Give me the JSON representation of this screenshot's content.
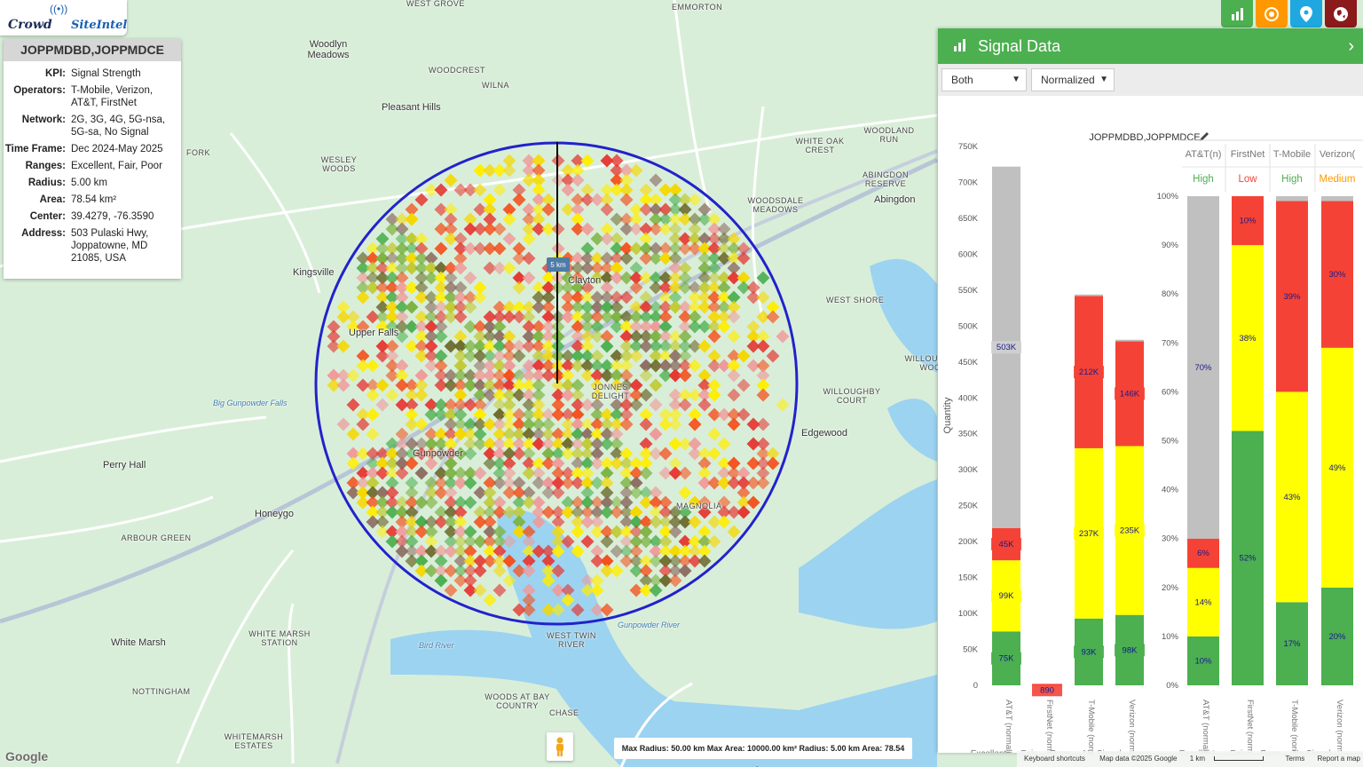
{
  "logo": {
    "part1": "Crowd",
    "part2": "SiteIntel"
  },
  "info": {
    "title": "JOPPMDBD,JOPPMDCE",
    "rows": [
      {
        "k": "KPI:",
        "v": "Signal Strength"
      },
      {
        "k": "Operators:",
        "v": "T-Mobile, Verizon, AT&T, FirstNet"
      },
      {
        "k": "Network:",
        "v": "2G, 3G, 4G, 5G-nsa, 5G-sa, No Signal"
      },
      {
        "k": "Time Frame:",
        "v": "Dec 2024-May 2025"
      },
      {
        "k": "Ranges:",
        "v": "Excellent, Fair, Poor"
      },
      {
        "k": "Radius:",
        "v": "5.00 km"
      },
      {
        "k": "Area:",
        "v": "78.54 km²"
      },
      {
        "k": "Center:",
        "v": "39.4279, -76.3590"
      },
      {
        "k": "Address:",
        "v": "503 Pulaski Hwy, Joppatowne, MD 21085, USA"
      }
    ]
  },
  "toolbar": {
    "colors": {
      "chart": "#4caf50",
      "target": "#ff9800",
      "pin": "#1fa8e0",
      "globe": "#8b1a1a"
    }
  },
  "panel": {
    "title": "Signal Data",
    "operator_filter": "Both",
    "mode_select": "Normalized",
    "chart_title": "JOPPMDBD,JOPPMDCE"
  },
  "map": {
    "places": [
      {
        "t": "WEST GROVE",
        "c": "small"
      },
      {
        "t": "EMMORTON",
        "c": "small"
      },
      {
        "t": "Woodlyn Meadows",
        "c": ""
      },
      {
        "t": "WOODCREST",
        "c": "small"
      },
      {
        "t": "WILNA",
        "c": "small"
      },
      {
        "t": "Pleasant Hills",
        "c": ""
      },
      {
        "t": "WOODLAND RUN",
        "c": "small"
      },
      {
        "t": "WHITE OAK CREST",
        "c": "small"
      },
      {
        "t": "ABINGDON RESERVE",
        "c": "small"
      },
      {
        "t": "Abingdon",
        "c": ""
      },
      {
        "t": "WOODSDALE MEADOWS",
        "c": "small"
      },
      {
        "t": "FORK",
        "c": "small"
      },
      {
        "t": "WESLEY WOODS",
        "c": "small"
      },
      {
        "t": "Kingsville",
        "c": ""
      },
      {
        "t": "WEST SHORE",
        "c": "small"
      },
      {
        "t": "WILLOUGHBY WOOD",
        "c": "small"
      },
      {
        "t": "WILLOUGHBY COURT",
        "c": "small"
      },
      {
        "t": "Edgewood",
        "c": ""
      },
      {
        "t": "Perry Hall",
        "c": ""
      },
      {
        "t": "Honeygo",
        "c": ""
      },
      {
        "t": "ARBOUR GREEN",
        "c": "small"
      },
      {
        "t": "White Marsh",
        "c": ""
      },
      {
        "t": "WHITE MARSH STATION",
        "c": "small"
      },
      {
        "t": "NOTTINGHAM",
        "c": "small"
      },
      {
        "t": "WHITEMARSH ESTATES",
        "c": "small"
      },
      {
        "t": "WEST TWIN RIVER",
        "c": "small"
      },
      {
        "t": "WOODS AT BAY COUNTRY",
        "c": "small"
      },
      {
        "t": "CHASE",
        "c": "small"
      },
      {
        "t": "MAGNOLIA",
        "c": "small"
      },
      {
        "t": "Bird River",
        "c": "water"
      },
      {
        "t": "Gunpowder River",
        "c": "water"
      },
      {
        "t": "Big Gunpowder Falls",
        "c": "water"
      },
      {
        "t": "Clayton",
        "c": ""
      },
      {
        "t": "JONNES DELIGHT",
        "c": "small"
      },
      {
        "t": "Upper Falls",
        "c": ""
      },
      {
        "t": "Gunpowder",
        "c": ""
      }
    ],
    "radius_label": "5 km"
  },
  "footer": {
    "stats": "Max Radius: 50.00 km  Max Area: 10000.00 km²  Radius: 5.00 km  Area: 78.54 km²",
    "google": "Google",
    "links": [
      "Keyboard shortcuts",
      "Map data ©2025 Google",
      "1 km",
      "Terms",
      "Report a map error"
    ]
  },
  "chart_data": [
    {
      "type": "bar",
      "stacked": true,
      "ylabel": "Quantity",
      "ylim": [
        0,
        750000
      ],
      "yticks": [
        "0",
        "50K",
        "100K",
        "150K",
        "200K",
        "250K",
        "300K",
        "350K",
        "400K",
        "450K",
        "500K",
        "550K",
        "600K",
        "650K",
        "700K",
        "750K"
      ],
      "categories": [
        "AT&T (normalized)",
        "FirstNet (normalized)",
        "T-Mobile (normalized)",
        "Verizon (normalized)"
      ],
      "series": [
        {
          "name": "Excellent",
          "color": "#4caf50",
          "values": [
            75000,
            0,
            93000,
            98000
          ],
          "labels": [
            "75K",
            "",
            "93K",
            "98K"
          ]
        },
        {
          "name": "Fair",
          "color": "#ffff00",
          "values": [
            99000,
            0,
            237000,
            235000
          ],
          "labels": [
            "99K",
            "",
            "237K",
            "235K"
          ]
        },
        {
          "name": "Poor",
          "color": "#f44336",
          "values": [
            45000,
            890,
            212000,
            146000
          ],
          "labels": [
            "45K",
            "890",
            "212K",
            "146K"
          ]
        },
        {
          "name": "No Signal",
          "color": "#c0c0c0",
          "values": [
            503000,
            0,
            2000,
            2000
          ],
          "labels": [
            "503K",
            "",
            "",
            ""
          ]
        }
      ]
    },
    {
      "type": "bar",
      "stacked": true,
      "ylim": [
        0,
        100
      ],
      "yticks": [
        "0%",
        "10%",
        "20%",
        "30%",
        "40%",
        "50%",
        "60%",
        "70%",
        "80%",
        "90%",
        "100%"
      ],
      "categories": [
        "AT&T (normalized)",
        "FirstNet (normalized)",
        "T-Mobile (normalized)",
        "Verizon (normalized)"
      ],
      "headers": [
        "AT&T(n)",
        "FirstNet",
        "T-Mobile",
        "Verizon("
      ],
      "ratings": [
        "High",
        "Low",
        "High",
        "Medium"
      ],
      "rating_colors": [
        "#4caf50",
        "#f44336",
        "#4caf50",
        "#ff9800"
      ],
      "series": [
        {
          "name": "Excellent",
          "color": "#4caf50",
          "values": [
            10,
            52,
            17,
            20
          ],
          "labels": [
            "10%",
            "52%",
            "17%",
            "20%"
          ]
        },
        {
          "name": "Fair",
          "color": "#ffff00",
          "values": [
            14,
            38,
            43,
            49
          ],
          "labels": [
            "14%",
            "38%",
            "43%",
            "49%"
          ]
        },
        {
          "name": "Poor",
          "color": "#f44336",
          "values": [
            6,
            10,
            39,
            30
          ],
          "labels": [
            "6%",
            "10%",
            "39%",
            "30%"
          ]
        },
        {
          "name": "No Signal",
          "color": "#c0c0c0",
          "values": [
            70,
            0,
            1,
            1
          ],
          "labels": [
            "70%",
            "",
            "",
            ""
          ]
        }
      ]
    }
  ]
}
